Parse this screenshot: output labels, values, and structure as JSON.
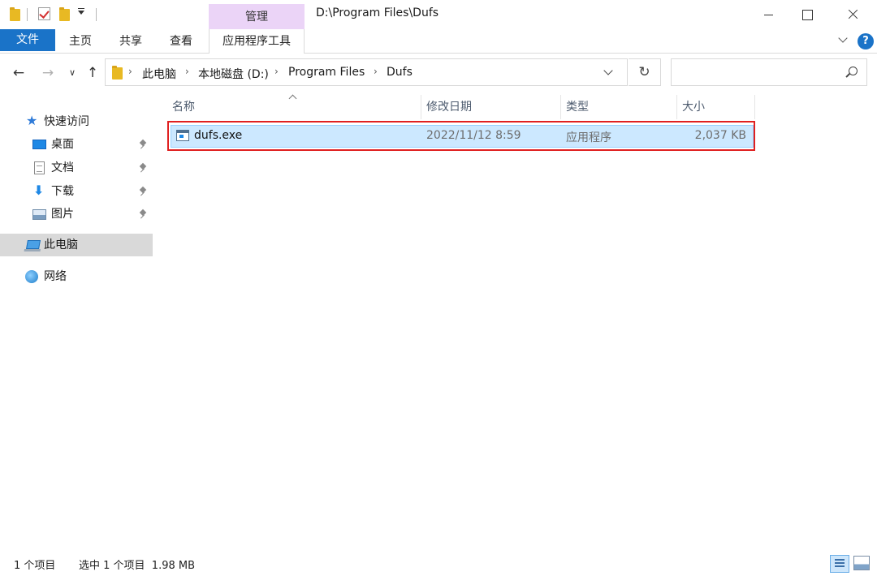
{
  "window": {
    "title": "D:\\Program Files\\Dufs",
    "context_tab_group": "管理"
  },
  "ribbon": {
    "file": "文件",
    "tabs": [
      "主页",
      "共享",
      "查看"
    ],
    "context_tab": "应用程序工具",
    "help": "?"
  },
  "nav": {
    "back": "←",
    "forward": "→",
    "recent": "∨",
    "up": "↑",
    "refresh": "↻"
  },
  "address": {
    "crumbs": [
      "此电脑",
      "本地磁盘 (D:)",
      "Program Files",
      "Dufs"
    ],
    "separator": "›"
  },
  "search": {
    "placeholder": ""
  },
  "sidebar": {
    "quick_access": "快速访问",
    "items": [
      {
        "label": "桌面",
        "icon": "desktop-icon",
        "pinned": true
      },
      {
        "label": "文档",
        "icon": "document-icon",
        "pinned": true
      },
      {
        "label": "下载",
        "icon": "download-icon",
        "pinned": true
      },
      {
        "label": "图片",
        "icon": "pictures-icon",
        "pinned": true
      }
    ],
    "this_pc": "此电脑",
    "network": "网络"
  },
  "columns": {
    "name": "名称",
    "date": "修改日期",
    "type": "类型",
    "size": "大小"
  },
  "files": [
    {
      "name": "dufs.exe",
      "date": "2022/11/12 8:59",
      "type": "应用程序",
      "size": "2,037 KB",
      "selected": true
    }
  ],
  "status": {
    "count": "1 个项目",
    "selected": "选中 1 个项目  1.98 MB"
  },
  "colors": {
    "accent": "#1a73c8",
    "selection": "#cce8ff",
    "context_tab": "#ebd4f7",
    "highlight": "#e02020"
  }
}
